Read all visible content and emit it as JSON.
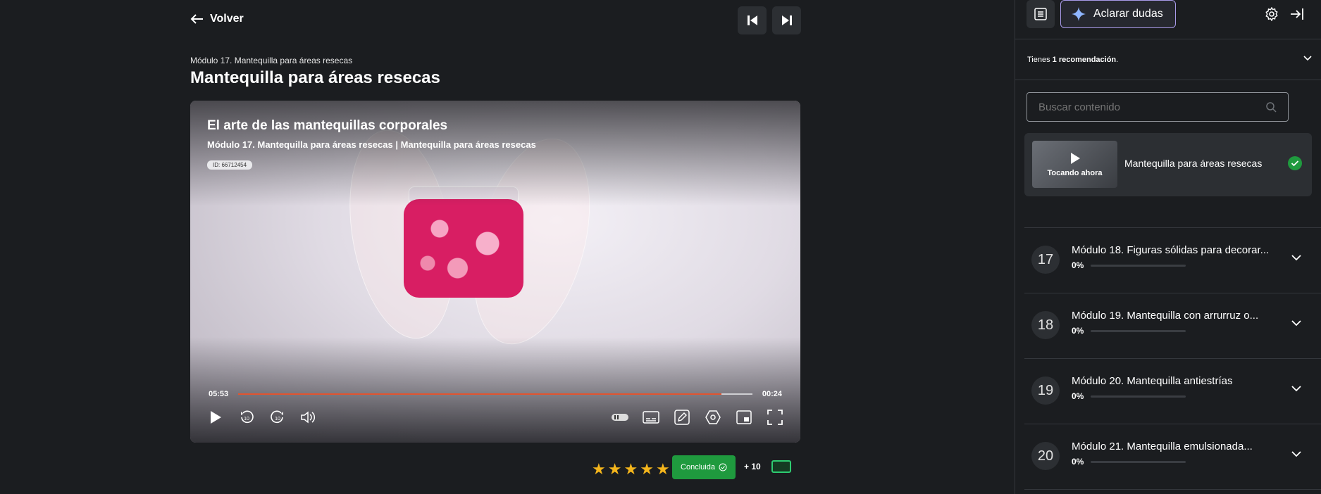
{
  "header": {
    "back_label": "Volver",
    "breadcrumb": "Módulo 17. Mantequilla para áreas resecas",
    "title": "Mantequilla para áreas resecas"
  },
  "player": {
    "video_title": "El arte de las mantequillas corporales",
    "video_subtitle": "Módulo 17. Mantequilla para áreas resecas | Mantequilla para áreas resecas",
    "video_id": "ID: 66712454",
    "elapsed": "05:53",
    "remaining": "00:24",
    "progress": 0.94,
    "controls": [
      "play-icon",
      "rewind-10-icon",
      "forward-10-icon",
      "volume-icon",
      "autoplay-toggle-icon",
      "subtitles-icon",
      "notes-icon",
      "settings-hex-icon",
      "picture-in-picture-icon",
      "fullscreen-icon"
    ]
  },
  "rating": {
    "stars": 5,
    "done_label": "Concluida",
    "points_label": "+ 10"
  },
  "sidebar": {
    "ask_label": "Aclarar dudas",
    "reco_prefix": "Tienes ",
    "reco_bold": "1 recomendación",
    "reco_suffix": ".",
    "search_placeholder": "Buscar contenido",
    "now_playing": {
      "thumb_label": "Tocando ahora",
      "title": "Mantequilla para áreas resecas"
    },
    "modules": [
      {
        "num": "17",
        "title": "Módulo 18. Figuras sólidas para decorar...",
        "pct": "0%"
      },
      {
        "num": "18",
        "title": "Módulo 19. Mantequilla con arrurruz o...",
        "pct": "0%"
      },
      {
        "num": "19",
        "title": "Módulo 20. Mantequilla antiestrías",
        "pct": "0%"
      },
      {
        "num": "20",
        "title": "Módulo 21. Mantequilla emulsionada...",
        "pct": "0%"
      }
    ]
  },
  "colors": {
    "accent_progress": "#e2542f",
    "success": "#1f9a3e",
    "star": "#f4b51c",
    "ask_border": "#a89ae8"
  }
}
